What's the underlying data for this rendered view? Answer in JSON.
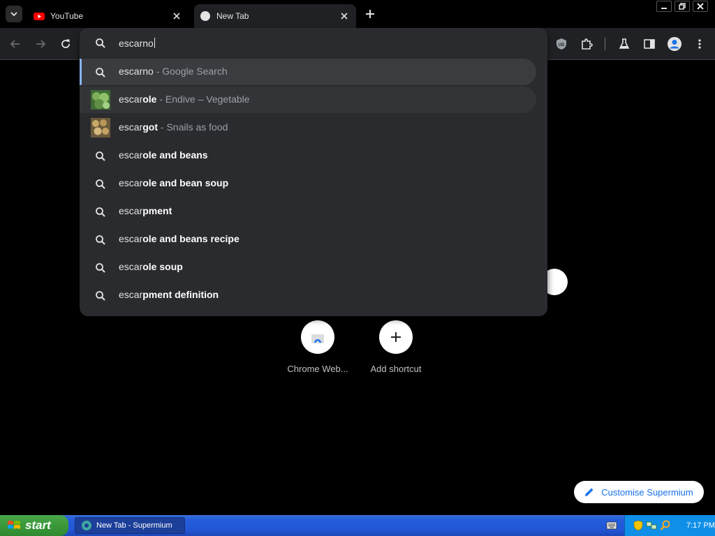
{
  "tabs": [
    {
      "title": "YouTube",
      "favicon": "youtube-icon"
    },
    {
      "title": "New Tab",
      "favicon": "globe-icon",
      "active": true
    }
  ],
  "omnibox": {
    "input_value": "escarno",
    "suggestions": [
      {
        "bold": "",
        "normal": "escarno",
        "desc": " - Google Search",
        "icon": "search-icon",
        "selected": true
      },
      {
        "normal": "escar",
        "bold": "ole",
        "desc": " - Endive – Vegetable",
        "icon": "escarole-thumbnail",
        "hovered": true
      },
      {
        "normal": "escar",
        "bold": "got",
        "desc": " - Snails as food",
        "icon": "escargot-thumbnail"
      },
      {
        "normal": "escar",
        "bold": "ole and beans",
        "desc": "",
        "icon": "search-icon"
      },
      {
        "normal": "escar",
        "bold": "ole and bean soup",
        "desc": "",
        "icon": "search-icon"
      },
      {
        "normal": "escar",
        "bold": "pment",
        "desc": "",
        "icon": "search-icon"
      },
      {
        "normal": "escar",
        "bold": "ole and beans recipe",
        "desc": "",
        "icon": "search-icon"
      },
      {
        "normal": "escar",
        "bold": "ole soup",
        "desc": "",
        "icon": "search-icon"
      },
      {
        "normal": "escar",
        "bold": "pment definition",
        "desc": "",
        "icon": "search-icon"
      }
    ]
  },
  "shortcuts": [
    {
      "label": "Chrome Web...",
      "icon": "chrome-web-store-icon"
    },
    {
      "label": "Add shortcut",
      "icon": "plus-icon"
    }
  ],
  "customise_label": "Customise Supermium",
  "taskbar": {
    "start_label": "start",
    "task_item": "New Tab - Supermium",
    "clock": "7:17 PM"
  },
  "colors": {
    "accent": "#8ab4f8",
    "customise_text": "#1a73e8",
    "taskbar_blue": "#245edb",
    "start_green": "#3c9b3c"
  }
}
